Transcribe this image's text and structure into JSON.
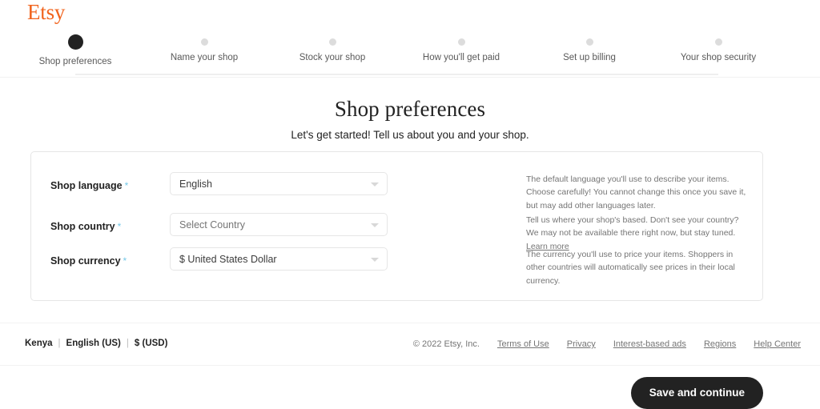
{
  "brand": {
    "logo_text": "Etsy",
    "logo_color": "#f1641e"
  },
  "stepper": {
    "steps": [
      {
        "label": "Shop preferences",
        "state": "active"
      },
      {
        "label": "Name your shop",
        "state": "upcoming"
      },
      {
        "label": "Stock your shop",
        "state": "upcoming"
      },
      {
        "label": "How you'll get paid",
        "state": "upcoming"
      },
      {
        "label": "Set up billing",
        "state": "upcoming"
      },
      {
        "label": "Your shop security",
        "state": "upcoming"
      }
    ],
    "active_dot_color": "#222222",
    "inactive_dot_color": "#dcdcdc"
  },
  "page": {
    "title": "Shop preferences",
    "subtitle": "Let's get started! Tell us about you and your shop."
  },
  "form": {
    "required_marker": "*",
    "required_marker_color": "#75c8e8",
    "fields": [
      {
        "label": "Shop language",
        "value": "English",
        "is_placeholder": false,
        "helper": "The default language you'll use to describe your items. Choose carefully! You cannot change this once you save it, but may add other languages later.",
        "helper_link": "",
        "helper_tail": ""
      },
      {
        "label": "Shop country",
        "value": "Select Country",
        "is_placeholder": true,
        "helper": "Tell us where your shop's based. Don't see your country? We may not be available there right now, but stay tuned. ",
        "helper_link": "Learn more",
        "helper_tail": ""
      },
      {
        "label": "Shop currency",
        "value": "$ United States Dollar",
        "is_placeholder": false,
        "helper": "The currency you'll use to price your items. Shoppers in other countries will automatically see prices in their local currency.",
        "helper_link": "",
        "helper_tail": ""
      }
    ],
    "caret_icon": "chevron-down-icon"
  },
  "footer": {
    "locale": {
      "region": "Kenya",
      "language": "English (US)",
      "currency": "$ (USD)",
      "separator": "|"
    },
    "copyright": "© 2022 Etsy, Inc.",
    "links": [
      "Terms of Use",
      "Privacy",
      "Interest-based ads",
      "Regions",
      "Help Center"
    ]
  },
  "action_bar": {
    "primary_label": "Save and continue",
    "primary_bg": "#222222"
  }
}
